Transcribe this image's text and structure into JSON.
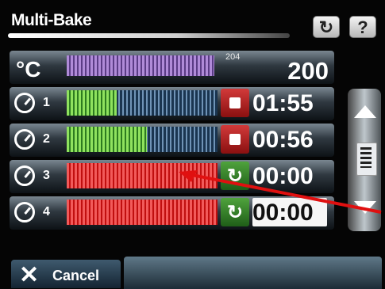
{
  "header": {
    "title": "Multi-Bake",
    "back_icon": "↻",
    "help_label": "?"
  },
  "temperature": {
    "unit_label": "°C",
    "setpoint": "204",
    "value": "200",
    "bar_color": "#b08bd8"
  },
  "timers": [
    {
      "slot": "1",
      "time": "01:55",
      "progress": 0.33,
      "bar_color": "#79d54d",
      "action": "stop"
    },
    {
      "slot": "2",
      "time": "00:56",
      "progress": 0.53,
      "bar_color": "#79d54d",
      "action": "stop"
    },
    {
      "slot": "3",
      "time": "00:00",
      "progress": 1.0,
      "bar_color": "#e02424",
      "action": "restart"
    },
    {
      "slot": "4",
      "time": "00:00",
      "progress": 1.0,
      "bar_color": "#e02424",
      "action": "restart"
    }
  ],
  "footer": {
    "cancel_label": "Cancel"
  },
  "colors": {
    "stop_button": "#b41f1f",
    "restart_button": "#2e7d24",
    "remaining_bar": "#2a4a6a"
  }
}
